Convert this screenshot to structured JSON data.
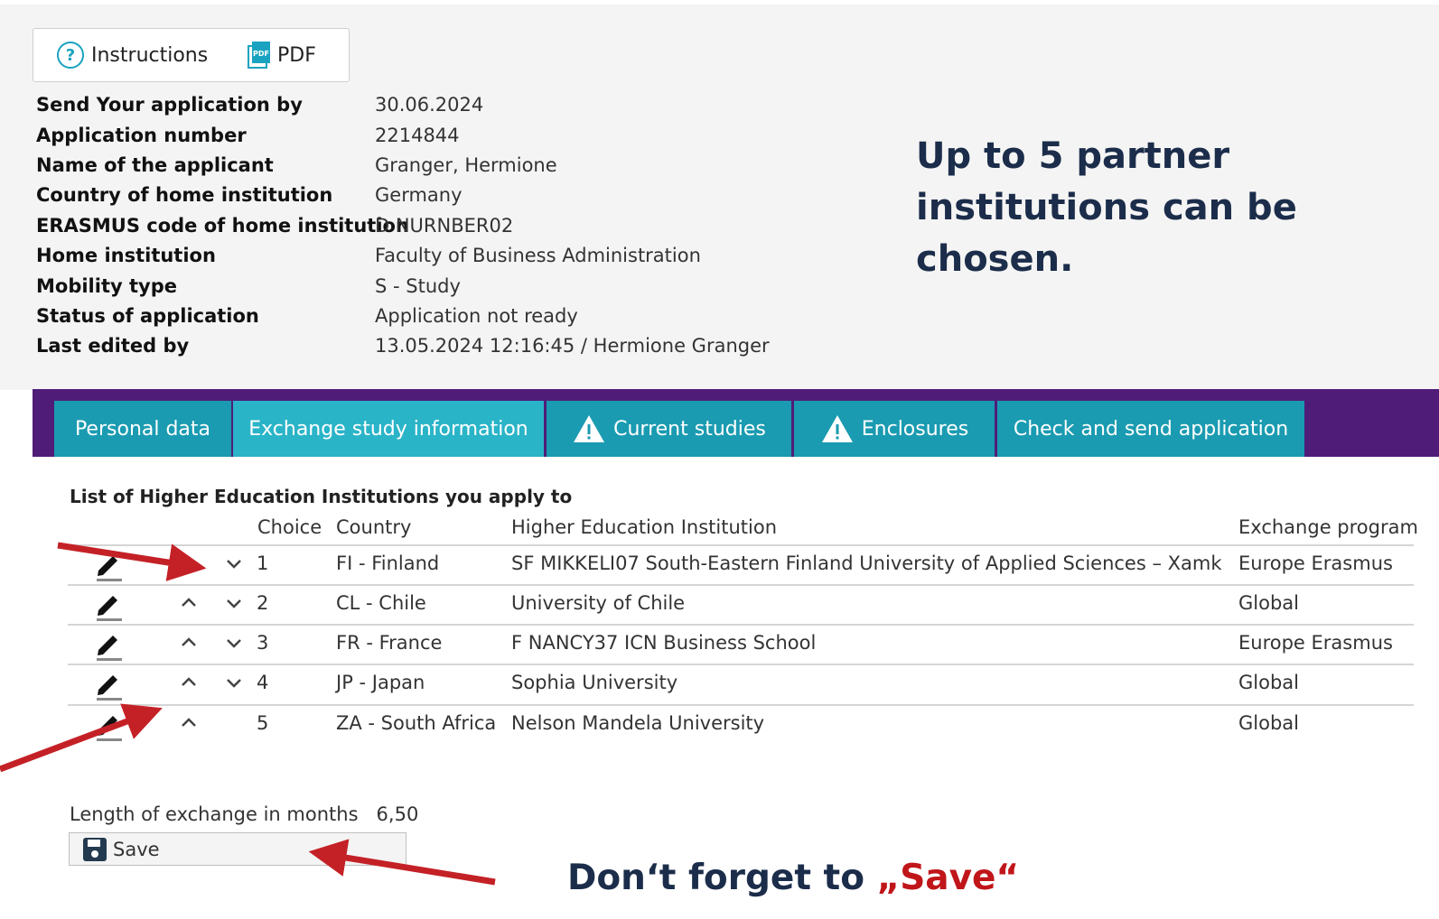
{
  "toolbar": {
    "instructions_label": "Instructions",
    "pdf_label": "PDF",
    "pdf_icon_text": "PDF"
  },
  "application_info": [
    {
      "label": "Send Your application by",
      "value": "30.06.2024"
    },
    {
      "label": "Application number",
      "value": "2214844"
    },
    {
      "label": "Name of the applicant",
      "value": "Granger, Hermione"
    },
    {
      "label": "Country of home institution",
      "value": "Germany"
    },
    {
      "label": "ERASMUS code of home institution",
      "value": "D NURNBER02"
    },
    {
      "label": "Home institution",
      "value": "Faculty of Business Administration"
    },
    {
      "label": "Mobility type",
      "value": "S - Study"
    },
    {
      "label": "Status of application",
      "value": "Application not ready"
    },
    {
      "label": "Last edited by",
      "value": "13.05.2024 12:16:45 / Hermione Granger"
    }
  ],
  "callout_text": "Up to 5 partner institutions can be chosen.",
  "tabs": [
    {
      "label": "Personal data",
      "warning": false,
      "active": false
    },
    {
      "label": "Exchange study information",
      "warning": false,
      "active": true
    },
    {
      "label": "Current studies",
      "warning": true,
      "active": false
    },
    {
      "label": "Enclosures",
      "warning": true,
      "active": false
    },
    {
      "label": "Check and send application",
      "warning": false,
      "active": false
    }
  ],
  "institutions": {
    "title": "List of Higher Education Institutions you apply to",
    "headers": {
      "choice": "Choice",
      "country": "Country",
      "institution": "Higher Education Institution",
      "program": "Exchange program"
    },
    "rows": [
      {
        "choice": "1",
        "country": "FI - Finland",
        "institution": "SF MIKKELI07 South-Eastern Finland University of Applied Sciences – Xamk",
        "program": "Europe Erasmus",
        "up": false,
        "down": true
      },
      {
        "choice": "2",
        "country": "CL - Chile",
        "institution": "University of Chile",
        "program": "Global",
        "up": true,
        "down": true
      },
      {
        "choice": "3",
        "country": "FR - France",
        "institution": "F NANCY37 ICN Business School",
        "program": "Europe Erasmus",
        "up": true,
        "down": true
      },
      {
        "choice": "4",
        "country": "JP - Japan",
        "institution": "Sophia University",
        "program": "Global",
        "up": true,
        "down": true
      },
      {
        "choice": "5",
        "country": "ZA - South Africa",
        "institution": "Nelson Mandela University",
        "program": "Global",
        "up": true,
        "down": false
      }
    ]
  },
  "length": {
    "label": "Length of exchange in months",
    "value": "6,50"
  },
  "save_label": "Save",
  "bottom_callout": {
    "prefix": "Don‘t forget to ",
    "highlight": "„Save“"
  },
  "colors": {
    "tab_bar": "#4f1d78",
    "tab": "#1a9bb1",
    "tab_active": "#2ab4c8",
    "callout_text": "#1b2d4a",
    "annotation_arrow": "#c42127"
  }
}
